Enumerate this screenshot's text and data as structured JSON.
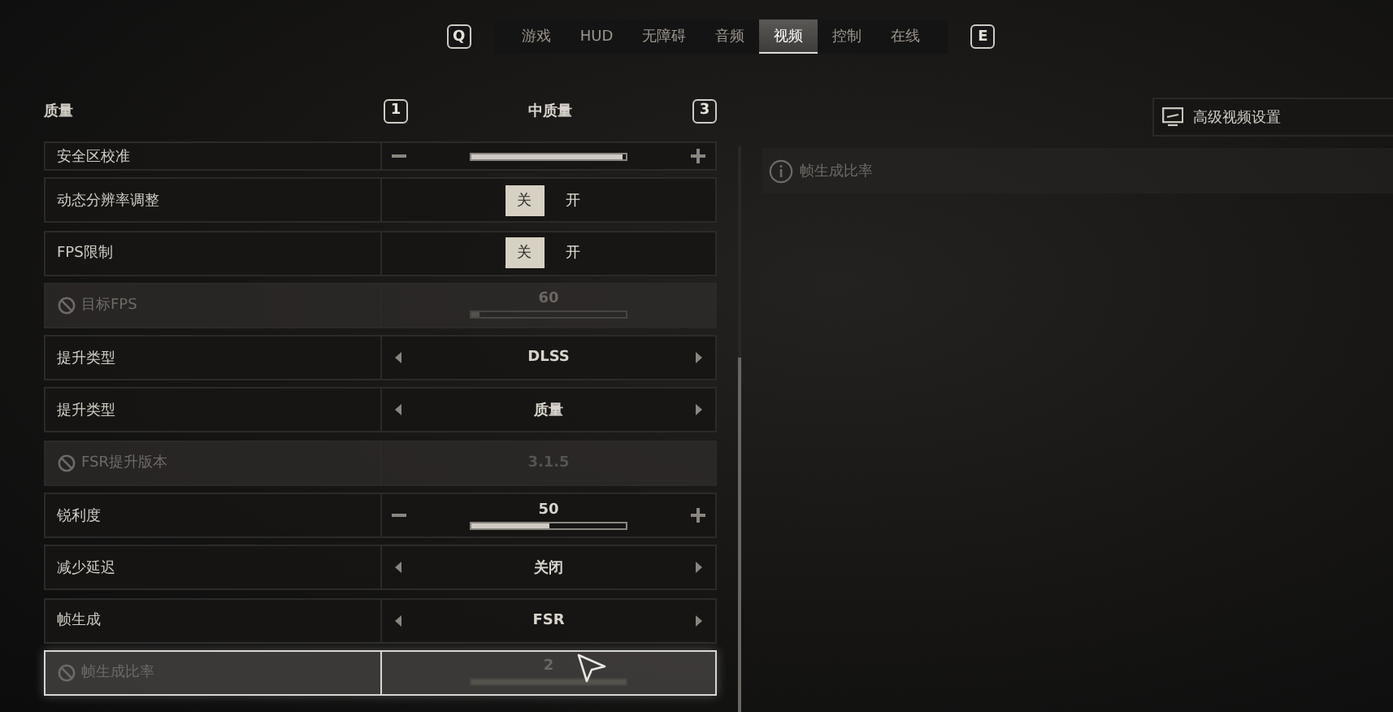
{
  "tabs": {
    "prev_key": "Q",
    "next_key": "E",
    "items": [
      {
        "label": "游戏",
        "selected": false
      },
      {
        "label": "HUD",
        "selected": false
      },
      {
        "label": "无障碍",
        "selected": false
      },
      {
        "label": "音频",
        "selected": false
      },
      {
        "label": "视频",
        "selected": true
      },
      {
        "label": "控制",
        "selected": false
      },
      {
        "label": "在线",
        "selected": false
      }
    ]
  },
  "settings": {
    "title": "质量",
    "preset": {
      "prev_key": "1",
      "value": "中质量",
      "next_key": "3"
    },
    "rows": [
      {
        "kind": "slider",
        "label": "安全区校准",
        "level": 0.98,
        "disabled": false,
        "focused": false,
        "cut": true
      },
      {
        "kind": "toggle",
        "label": "动态分辨率调整",
        "disabled": false,
        "focused": false,
        "options": [
          {
            "label": "关",
            "selected": true
          },
          {
            "label": "开",
            "selected": false
          }
        ]
      },
      {
        "kind": "toggle",
        "label": "FPS限制",
        "disabled": false,
        "focused": false,
        "options": [
          {
            "label": "关",
            "selected": true
          },
          {
            "label": "开",
            "selected": false
          }
        ]
      },
      {
        "kind": "slider",
        "label": "目标FPS",
        "value": "60",
        "level": 0.05,
        "disabled": true,
        "focused": false
      },
      {
        "kind": "selector",
        "label": "提升类型",
        "value": "DLSS",
        "disabled": false,
        "focused": false
      },
      {
        "kind": "selector",
        "label": "提升类型",
        "value": "质量",
        "disabled": false,
        "focused": false
      },
      {
        "kind": "selector",
        "label": "FSR提升版本",
        "value": "3.1.5",
        "disabled": true,
        "focused": false
      },
      {
        "kind": "slider",
        "label": "锐利度",
        "value": "50",
        "level": 0.5,
        "disabled": false,
        "focused": false
      },
      {
        "kind": "selector",
        "label": "减少延迟",
        "value": "关闭",
        "disabled": false,
        "focused": false
      },
      {
        "kind": "selector",
        "label": "帧生成",
        "value": "FSR",
        "disabled": false,
        "focused": false
      },
      {
        "kind": "slider",
        "label": "帧生成比率",
        "value": "2",
        "level": 1.0,
        "disabled": true,
        "focused": true
      }
    ]
  },
  "side": {
    "advanced_button": "高级视频设置",
    "info": "帧生成比率"
  }
}
